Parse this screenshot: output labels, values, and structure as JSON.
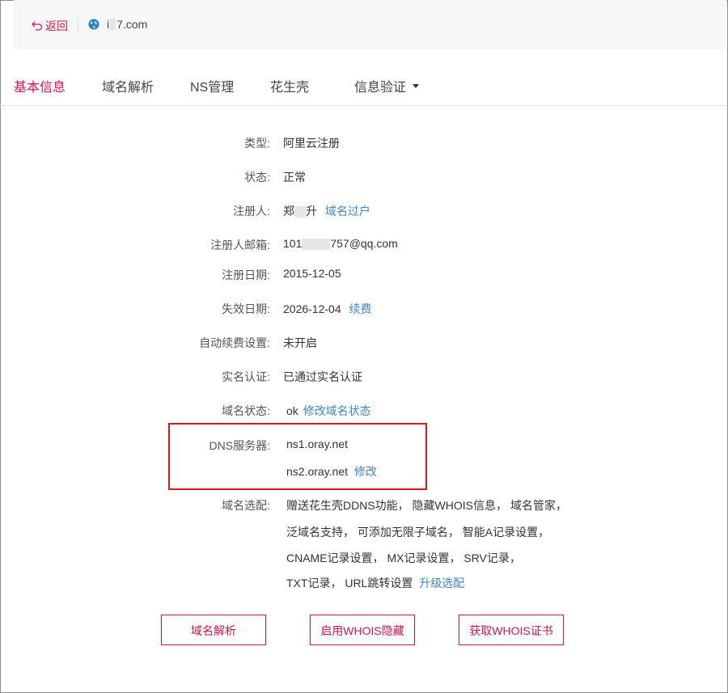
{
  "header": {
    "back_label": "返回",
    "domain_prefix": "i",
    "domain_suffix": "7.com"
  },
  "tabs": [
    {
      "label": "基本信息",
      "active": true
    },
    {
      "label": "域名解析"
    },
    {
      "label": "NS管理"
    },
    {
      "label": "花生壳"
    },
    {
      "label": "信息验证",
      "has_dropdown": true
    }
  ],
  "info": {
    "type_label": "类型:",
    "type_value": "阿里云注册",
    "status_label": "状态:",
    "status_value": "正常",
    "registrant_label": "注册人:",
    "registrant_first": "郑",
    "registrant_last": "升",
    "registrant_link": "域名过户",
    "email_label": "注册人邮箱:",
    "email_prefix": "101",
    "email_suffix": "757@qq.com",
    "regdate_label": "注册日期:",
    "regdate_value": "2015-12-05",
    "expdate_label": "失效日期:",
    "expdate_value": "2026-12-04",
    "renew_link": "续费",
    "autorenew_label": "自动续费设置:",
    "autorenew_value": "未开启",
    "realname_label": "实名认证:",
    "realname_value": "已通过实名认证",
    "domainstatus_label": "域名状态:",
    "domainstatus_value": "ok",
    "domainstatus_link": "修改域名状态",
    "dns_label": "DNS服务器:",
    "dns1": "ns1.oray.net",
    "dns2": "ns2.oray.net",
    "dns_modify_link": "修改",
    "options_label": "域名选配:",
    "options_line1": "赠送花生壳DDNS功能， 隐藏WHOIS信息， 域名管家，",
    "options_line2": "泛域名支持， 可添加无限子域名， 智能A记录设置，",
    "options_line3": "CNAME记录设置， MX记录设置， SRV记录，",
    "options_line4": "TXT记录， URL跳转设置",
    "options_upgrade_link": "升级选配"
  },
  "actions": {
    "resolve": "域名解析",
    "whois_hide": "启用WHOIS隐藏",
    "whois_cert": "获取WHOIS证书"
  },
  "colors": {
    "accent": "#d7164d",
    "link": "#3d86c6",
    "highlight_box": "#d9171d"
  }
}
